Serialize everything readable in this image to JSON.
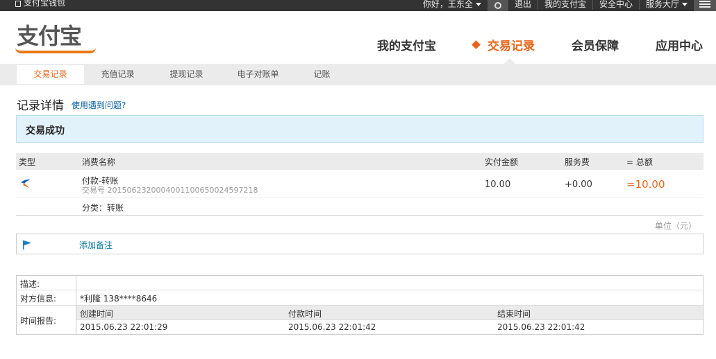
{
  "topbar": {
    "wallet_label": "支付宝钱包",
    "greeting": "你好，",
    "username": "王东全",
    "logout": "退出",
    "my_alipay": "我的支付宝",
    "security": "安全中心",
    "service": "服务大厅"
  },
  "header": {
    "logo_text": "支付宝",
    "nav": [
      {
        "label": "我的支付宝"
      },
      {
        "label": "交易记录"
      },
      {
        "label": "会员保障"
      },
      {
        "label": "应用中心"
      }
    ]
  },
  "subnav": {
    "tabs": [
      {
        "label": "交易记录"
      },
      {
        "label": "充值记录"
      },
      {
        "label": "提现记录"
      },
      {
        "label": "电子对账单"
      },
      {
        "label": "记账"
      }
    ]
  },
  "page": {
    "title": "记录详情",
    "help_link": "使用遇到问题?",
    "status": "交易成功"
  },
  "table": {
    "headers": {
      "type": "类型",
      "name": "消费名称",
      "amount": "实付金额",
      "fee": "服务费",
      "total": "= 总额"
    },
    "row": {
      "name": "付款-转账",
      "trade_no": "交易号 2015062320004001100650024597218",
      "amount": "10.00",
      "fee": "+0.00",
      "total": "=10.00",
      "category": "分类：转账"
    },
    "unit": "单位（元）"
  },
  "memo": {
    "add_label": "添加备注"
  },
  "info": {
    "desc_label": "描述:",
    "desc_value": "",
    "party_label": "对方信息:",
    "party_value": "*利隆 138****8646",
    "time_label": "时间报告:",
    "time_headers": [
      "创建时间",
      "付款时间",
      "结束时间"
    ],
    "time_values": [
      "2015.06.23 22:01:29",
      "2015.06.23 22:01:42",
      "2015.06.23 22:01:42"
    ]
  }
}
